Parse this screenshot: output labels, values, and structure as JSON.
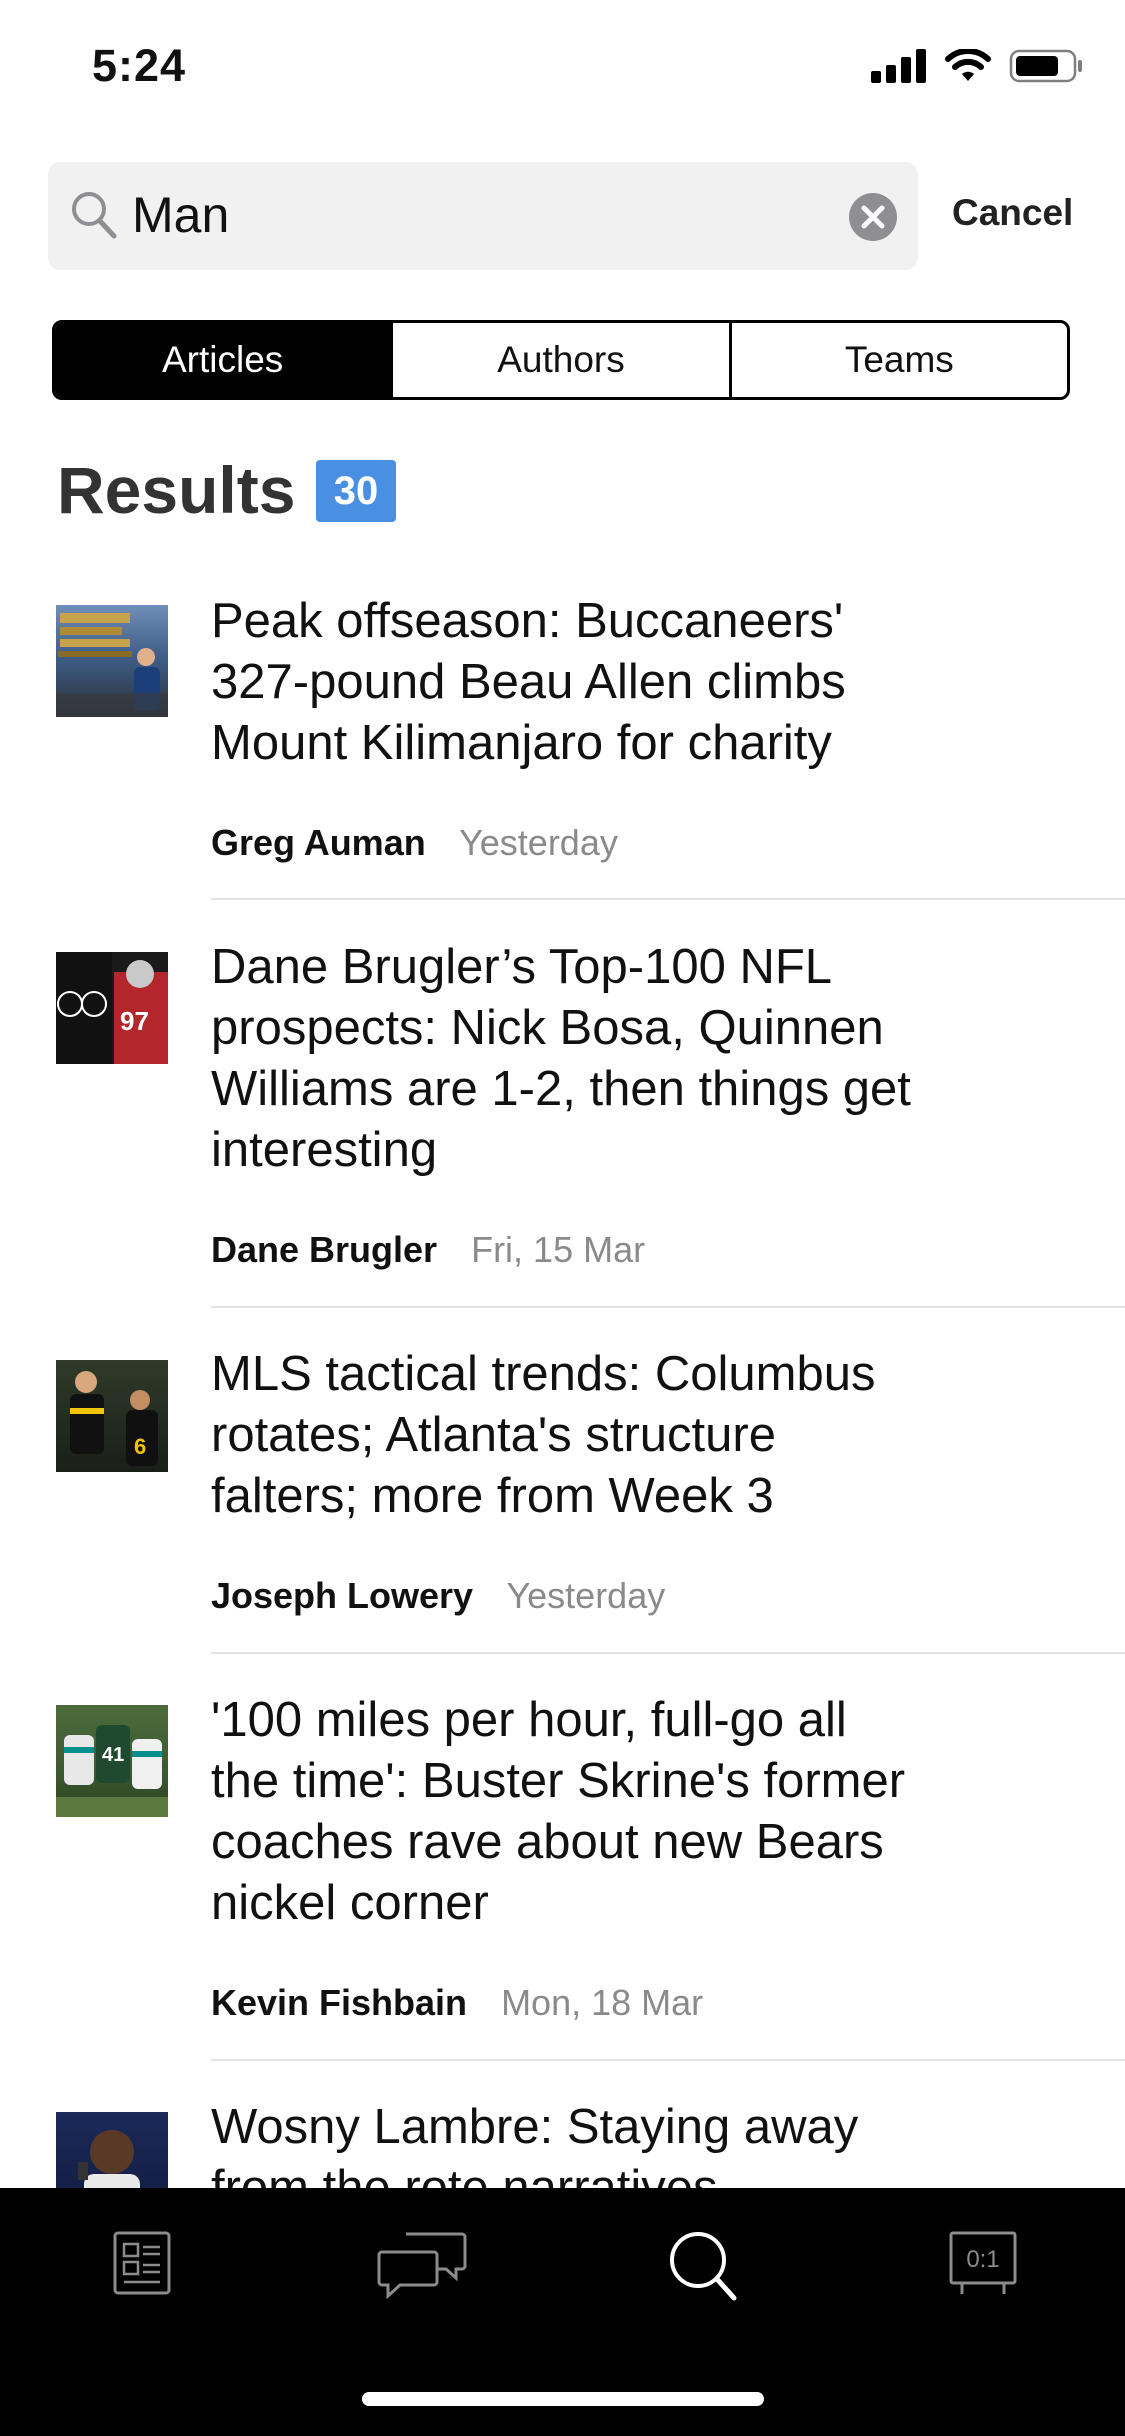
{
  "status": {
    "time": "5:24"
  },
  "search": {
    "query": "Man",
    "cancel_label": "Cancel"
  },
  "segments": [
    "Articles",
    "Authors",
    "Teams"
  ],
  "results": {
    "title": "Results",
    "count": "30"
  },
  "articles": [
    {
      "title_lines": [
        "Peak offseason: Buccaneers'",
        "327-pound Beau Allen climbs",
        "Mount Kilimanjaro for charity"
      ],
      "author": "Greg Auman",
      "date": "Yesterday"
    },
    {
      "title_lines": [
        "Dane Brugler’s Top-100 NFL",
        "prospects: Nick Bosa, Quinnen",
        "Williams are 1-2, then things get",
        "interesting"
      ],
      "author": "Dane Brugler",
      "date": "Fri, 15 Mar"
    },
    {
      "title_lines": [
        "MLS tactical trends: Columbus",
        "rotates; Atlanta's structure",
        "falters; more from Week 3"
      ],
      "author": "Joseph Lowery",
      "date": "Yesterday"
    },
    {
      "title_lines": [
        "'100 miles per hour, full-go all",
        "the time': Buster Skrine's former",
        "coaches rave about new Bears",
        "nickel corner"
      ],
      "author": "Kevin Fishbain",
      "date": "Mon, 18 Mar"
    },
    {
      "title_lines": [
        "Wosny Lambre: Staying away",
        "from the rote narratives"
      ],
      "author": "",
      "date": ""
    }
  ],
  "tabbar": [
    "news-icon",
    "chat-icon",
    "search-icon",
    "scores-icon"
  ],
  "colors": {
    "accent": "#4a90e2",
    "segment_active": "#000000",
    "tabbar_bg": "#000000"
  }
}
